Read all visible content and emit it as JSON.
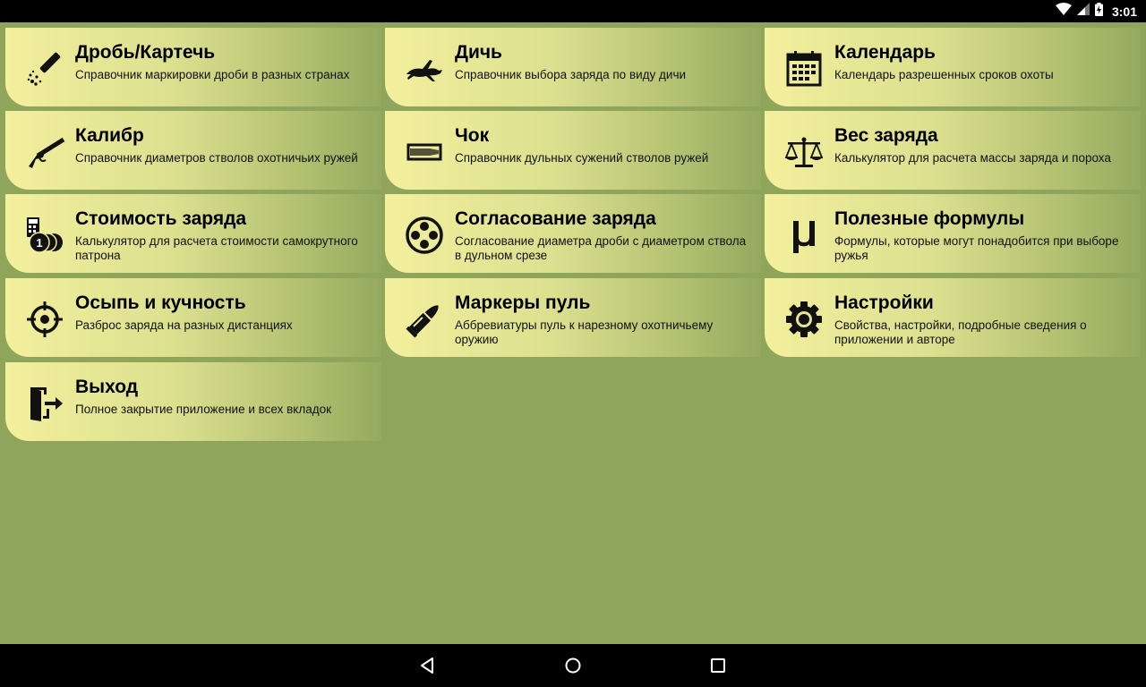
{
  "status": {
    "time": "3:01"
  },
  "tiles": [
    {
      "title": "Дробь/Картечь",
      "desc": "Справочник маркировки дроби в разных странах",
      "icon": "shot-shell-icon"
    },
    {
      "title": "Дичь",
      "desc": "Справочник выбора заряда по виду дичи",
      "icon": "hare-icon"
    },
    {
      "title": "Календарь",
      "desc": "Календарь разрешенных сроков охоты",
      "icon": "calendar-icon"
    },
    {
      "title": "Калибр",
      "desc": "Справочник диаметров стволов охотничьих ружей",
      "icon": "shotgun-icon"
    },
    {
      "title": "Чок",
      "desc": "Справочник дульных сужений стволов ружей",
      "icon": "barrel-choke-icon"
    },
    {
      "title": "Вес заряда",
      "desc": "Калькулятор для расчета массы заряда и пороха",
      "icon": "scales-icon"
    },
    {
      "title": "Стоимость заряда",
      "desc": "Калькулятор для расчета стоимости самокрутного патрона",
      "icon": "calculator-coins-icon"
    },
    {
      "title": "Согласование заряда",
      "desc": "Согласование диаметра дроби с диаметром ствола в дульном срезе",
      "icon": "shot-pattern-icon"
    },
    {
      "title": "Полезные формулы",
      "desc": "Формулы, которые могут понадобится при выборе ружья",
      "icon": "mu-formula-icon"
    },
    {
      "title": "Осыпь и кучность",
      "desc": "Разброс заряда на разных дистанциях",
      "icon": "crosshair-icon"
    },
    {
      "title": "Маркеры пуль",
      "desc": "Аббревиатуры пуль к нарезному охотничьему оружию",
      "icon": "bullet-icon"
    },
    {
      "title": "Настройки",
      "desc": "Свойства, настройки, подробные сведения о приложении и авторе",
      "icon": "gear-icon"
    },
    {
      "title": "Выход",
      "desc": "Полное закрытие приложение и всех вкладок",
      "icon": "exit-door-icon"
    }
  ],
  "colors": {
    "background": "#8fa55c",
    "tile_start": "#f3ef9d",
    "tile_end": "#94aa5f",
    "bars": "#000000"
  }
}
